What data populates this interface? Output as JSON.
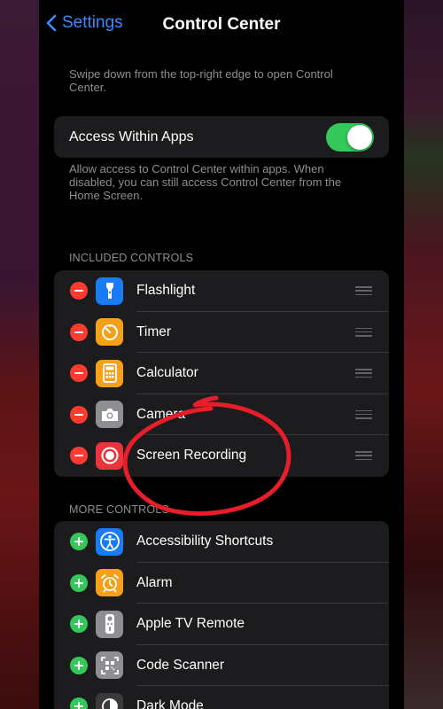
{
  "nav": {
    "back_label": "Settings",
    "title": "Control Center"
  },
  "intro_footnote": "Swipe down from the top-right edge to open Control Center.",
  "access": {
    "label": "Access Within Apps",
    "enabled": true,
    "footnote": "Allow access to Control Center within apps. When disabled, you can still access Control Center from the Home Screen."
  },
  "included": {
    "header": "INCLUDED CONTROLS",
    "items": [
      {
        "label": "Flashlight",
        "icon": "flashlight-icon",
        "color": "#1a7cf5"
      },
      {
        "label": "Timer",
        "icon": "timer-icon",
        "color": "#f5a01a"
      },
      {
        "label": "Calculator",
        "icon": "calculator-icon",
        "color": "#f5a01a"
      },
      {
        "label": "Camera",
        "icon": "camera-icon",
        "color": "#8e8e93"
      },
      {
        "label": "Screen Recording",
        "icon": "screen-recording-icon",
        "color": "#e8343a"
      }
    ]
  },
  "more": {
    "header": "MORE CONTROLS",
    "items": [
      {
        "label": "Accessibility Shortcuts",
        "icon": "accessibility-icon",
        "color": "#1a7cf5"
      },
      {
        "label": "Alarm",
        "icon": "alarm-icon",
        "color": "#f5a01a"
      },
      {
        "label": "Apple TV Remote",
        "icon": "remote-icon",
        "color": "#8e8e93"
      },
      {
        "label": "Code Scanner",
        "icon": "qr-code-icon",
        "color": "#8e8e93"
      },
      {
        "label": "Dark Mode",
        "icon": "dark-mode-icon",
        "color": "#3a3a3c"
      }
    ]
  },
  "colors": {
    "accent": "#3a8bff",
    "toggle_on": "#34c759",
    "remove": "#ff3b30",
    "add": "#34c759",
    "annotation": "#e81d2a"
  }
}
